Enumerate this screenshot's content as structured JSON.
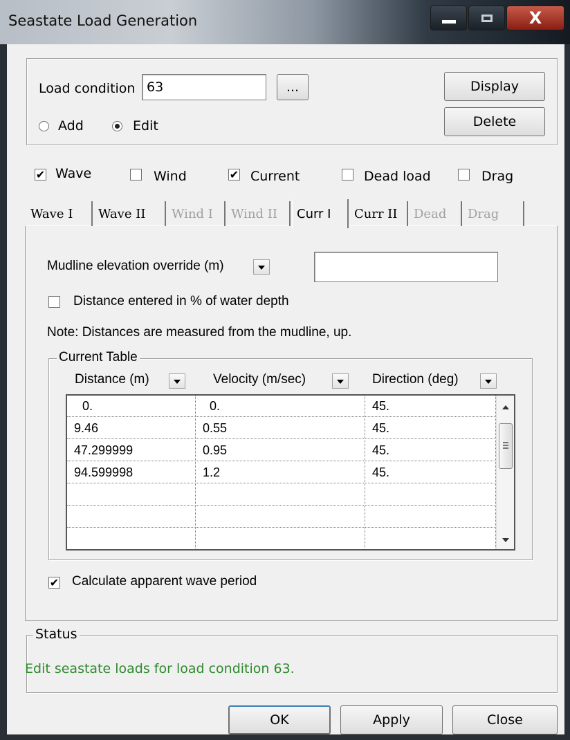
{
  "window": {
    "title": "Seastate Load Generation",
    "close_glyph": "X",
    "accent": "#2d8a2d"
  },
  "load": {
    "label": "Load condition",
    "value": "63",
    "browse_label": "...",
    "display_label": "Display",
    "delete_label": "Delete",
    "radios": [
      {
        "label": "Add",
        "checked": false
      },
      {
        "label": "Edit",
        "checked": true
      }
    ]
  },
  "load_types": [
    {
      "label": "Wave",
      "checked": true
    },
    {
      "label": "Wind",
      "checked": false
    },
    {
      "label": "Current",
      "checked": true
    },
    {
      "label": "Dead load",
      "checked": false
    },
    {
      "label": "Drag",
      "checked": false
    }
  ],
  "tabs": [
    {
      "label": "Wave I",
      "enabled": true
    },
    {
      "label": "Wave II",
      "enabled": true
    },
    {
      "label": "Wind I",
      "enabled": false
    },
    {
      "label": "Wind II",
      "enabled": false
    },
    {
      "label": "Curr I",
      "enabled": true,
      "active": true
    },
    {
      "label": "Curr II",
      "enabled": true
    },
    {
      "label": "Dead",
      "enabled": false
    },
    {
      "label": "Drag",
      "enabled": false
    }
  ],
  "curr": {
    "mudline_label": "Mudline elevation override (m)",
    "mudline_value": "",
    "percent_label": "Distance entered in % of water depth",
    "percent_checked": false,
    "note": "Note: Distances are measured from the mudline, up.",
    "table_caption": "Current Table",
    "columns": [
      "Distance (m)",
      "Velocity (m/sec)",
      "Direction (deg)"
    ],
    "rows": [
      [
        "0.",
        "0.",
        "45."
      ],
      [
        "9.46",
        "0.55",
        "45."
      ],
      [
        "47.299999",
        "0.95",
        "45."
      ],
      [
        "94.599998",
        "1.2",
        "45."
      ],
      [
        "",
        "",
        ""
      ],
      [
        "",
        "",
        ""
      ],
      [
        "",
        "",
        ""
      ]
    ],
    "apparent_label": "Calculate apparent wave period",
    "apparent_checked": true
  },
  "status": {
    "caption": "Status",
    "text": "Edit seastate loads for load condition 63."
  },
  "footer": {
    "ok_label": "OK",
    "apply_label": "Apply",
    "close_label": "Close"
  }
}
